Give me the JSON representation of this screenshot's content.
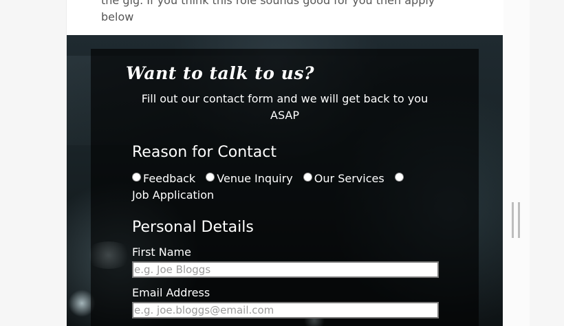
{
  "intro": {
    "text": "the gig. If you think this role sounds good for you then apply below"
  },
  "contact_form": {
    "title": "Want to talk to us?",
    "subtitle": "Fill out our contact form and we will get back to you ASAP",
    "reason_heading": "Reason for Contact",
    "reasons": [
      "Feedback",
      "Venue Inquiry",
      "Our Services",
      "Job Application"
    ],
    "personal_heading": "Personal Details",
    "first_name_label": "First Name",
    "first_name_placeholder": "e.g. Joe Bloggs",
    "email_label": "Email Address",
    "email_placeholder": "e.g. joe.bloggs@email.com"
  },
  "colors": {
    "panel_overlay": "#000000",
    "text": "#ffffff",
    "page_bg": "#f6f6f6"
  }
}
